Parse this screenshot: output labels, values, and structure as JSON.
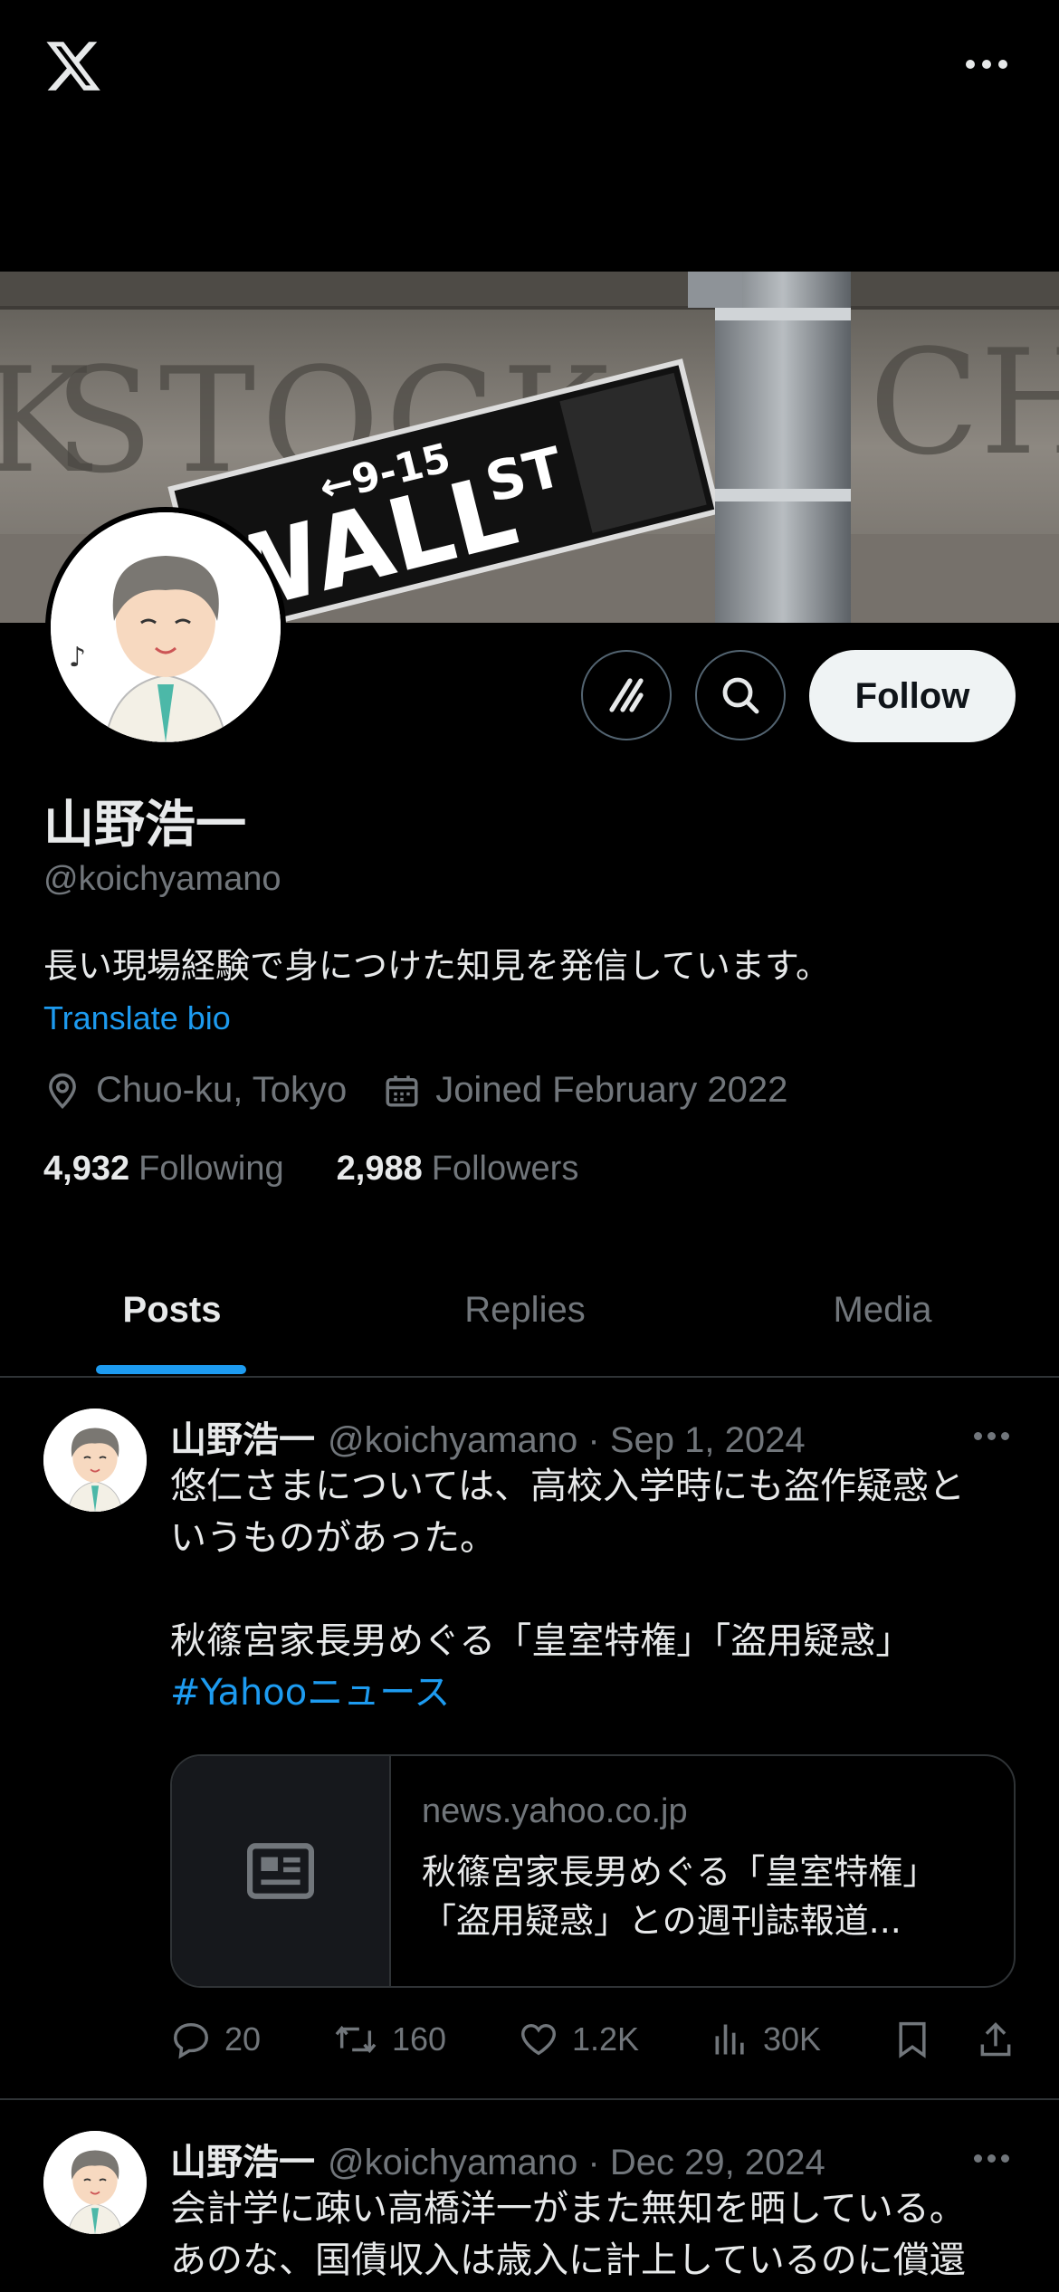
{
  "profile": {
    "name": "山野浩一",
    "handle": "@koichyamano",
    "bio": "長い現場経験で身につけた知見を発信しています。",
    "translate_label": "Translate bio",
    "location": "Chuo-ku, Tokyo",
    "joined": "Joined February 2022",
    "following_count": "4,932",
    "following_label": "Following",
    "followers_count": "2,988",
    "followers_label": "Followers",
    "follow_button": "Follow"
  },
  "banner": {
    "sign_arrow": "←9-15",
    "sign_street": "WALL",
    "sign_suffix": "ST",
    "wall_text_left": "STOCK",
    "wall_text_right": "CH",
    "wall_text_far_left": "K"
  },
  "tabs": [
    {
      "label": "Posts"
    },
    {
      "label": "Replies"
    },
    {
      "label": "Media"
    }
  ],
  "posts": [
    {
      "name": "山野浩一",
      "meta": "@koichyamano · Sep 1, 2024",
      "text_line1": "悠仁さまについては、高校入学時にも盗作疑惑と",
      "text_line2": "いうものがあった。",
      "text_line3": "秋篠宮家長男めぐる「皇室特権」「盗用疑惑」",
      "hashtag": "#Yahooニュース",
      "card_domain": "news.yahoo.co.jp",
      "card_title_line1": "秋篠宮家長男めぐる「皇室特権」",
      "card_title_line2": "「盗用疑惑」との週刊誌報道...",
      "replies": "20",
      "reposts": "160",
      "likes": "1.2K",
      "views": "30K"
    },
    {
      "name": "山野浩一",
      "meta": "@koichyamano · Dec 29, 2024",
      "text_line1": "会計学に疎い高橋洋一がまた無知を晒している。",
      "text_line2": "あのな、国債収入は歳入に計上しているのに償還"
    }
  ],
  "icons": {
    "logo": "x-logo-icon",
    "more": "more-icon",
    "grok": "grok-icon",
    "search": "search-icon",
    "location": "location-pin-icon",
    "calendar": "calendar-icon",
    "reply": "reply-icon",
    "repost": "repost-icon",
    "like": "heart-icon",
    "views": "views-icon",
    "bookmark": "bookmark-icon",
    "share": "share-icon"
  },
  "colors": {
    "background": "#000000",
    "accent": "#1d9bf0",
    "text_primary": "#e7e9ea",
    "text_secondary": "#71767b",
    "border": "#2f3336"
  }
}
